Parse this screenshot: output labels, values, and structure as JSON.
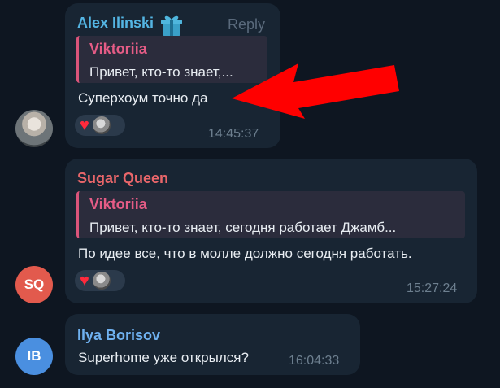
{
  "messages": [
    {
      "sender": "Alex Ilinski",
      "sender_color": "#54b5e3",
      "has_gift_icon": true,
      "reply_label": "Reply",
      "quote": {
        "name": "Viktoriia",
        "text": "Привет, кто-то знает,..."
      },
      "text": "Суперхоум точно да",
      "reactions": [
        "heart-icon"
      ],
      "time": "14:45:37"
    },
    {
      "sender": "Sugar Queen",
      "sender_color": "#e8666a",
      "quote": {
        "name": "Viktoriia",
        "text": "Привет, кто-то знает, сегодня работает Джамб..."
      },
      "text": "По идее все, что в молле должно сегодня работать.",
      "reactions": [
        "heart-icon"
      ],
      "time": "15:27:24",
      "avatar_initials": "SQ",
      "avatar_color": "#e25a4d"
    },
    {
      "sender": "Ilya Borisov",
      "sender_color": "#6fb1f0",
      "text": "Superhome уже открылся?",
      "time": "16:04:33",
      "avatar_initials": "IB",
      "avatar_color": "#4a8fe0"
    }
  ],
  "colors": {
    "background": "#0e1621",
    "bubble": "#182533",
    "arrow": "#ff0000"
  }
}
